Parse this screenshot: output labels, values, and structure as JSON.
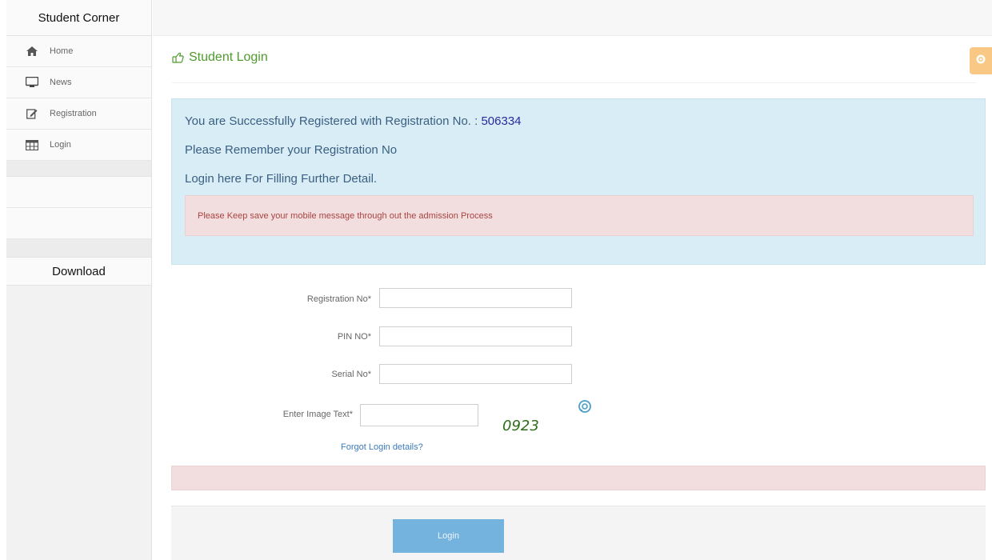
{
  "sidebar": {
    "title": "Student Corner",
    "items": [
      {
        "label": "Home",
        "icon": "home-icon"
      },
      {
        "label": "News",
        "icon": "monitor-icon"
      },
      {
        "label": "Registration",
        "icon": "edit-icon"
      },
      {
        "label": "Login",
        "icon": "calendar-icon"
      }
    ],
    "download_label": "Download"
  },
  "header": {
    "title": "Student Login"
  },
  "alert": {
    "line1_prefix": "You are Successfully Registered with Registration No. : ",
    "registration_number": "506334",
    "line2": "Please Remember your Registration No",
    "line3": "Login here For Filling Further Detail.",
    "warning": "Please Keep save your mobile message through out the admission Process"
  },
  "form": {
    "registration_label": "Registration No*",
    "pin_label": "PIN NO*",
    "serial_label": "Serial No*",
    "image_text_label": "Enter Image Text*",
    "captcha_text": "0923",
    "forgot_link": "Forgot Login details?",
    "login_button": "Login"
  },
  "colors": {
    "heading_green": "#4f9b2d",
    "info_bg": "#d9edf7",
    "danger_bg": "#f2dede",
    "danger_text": "#a94442",
    "button_blue": "#73b3de",
    "gear_orange": "#f8c884"
  }
}
